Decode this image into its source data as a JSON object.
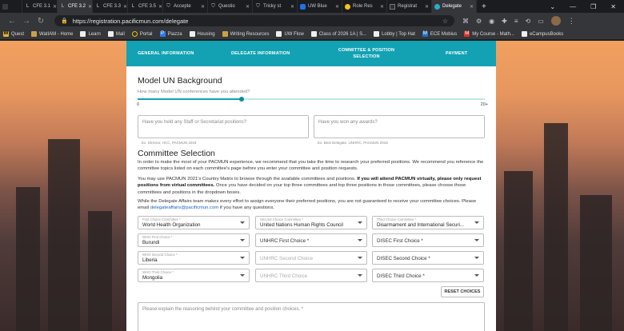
{
  "browser": {
    "tabs": [
      {
        "label": "CFE 3.1",
        "icon": "L"
      },
      {
        "label": "CFE 3.2",
        "icon": "L"
      },
      {
        "label": "CFE 3.3",
        "icon": "L"
      },
      {
        "label": "CFE 3.5",
        "icon": "L"
      },
      {
        "label": "Accepte",
        "icon": "shield"
      },
      {
        "label": "Questio",
        "icon": "shield"
      },
      {
        "label": "Tricky st",
        "icon": "shield"
      },
      {
        "label": "UW Blue",
        "icon": "blue"
      },
      {
        "label": "Role Res",
        "icon": "yellow"
      },
      {
        "label": "Registrat",
        "icon": "dark"
      },
      {
        "label": "Delegate",
        "icon": "teal"
      }
    ],
    "url": "https://registration.pacificmun.com/delegate",
    "bookmarks": [
      {
        "label": "Quest",
        "icon": "w"
      },
      {
        "label": "WatIAM - Home",
        "icon": "folder"
      },
      {
        "label": "Learn",
        "icon": "doc"
      },
      {
        "label": "Mail",
        "icon": "doc"
      },
      {
        "label": "Portal",
        "icon": "ring"
      },
      {
        "label": "Piazza",
        "icon": "p"
      },
      {
        "label": "Housing",
        "icon": "doc"
      },
      {
        "label": "Writing Resources",
        "icon": "folder"
      },
      {
        "label": "UW Flow",
        "icon": "doc"
      },
      {
        "label": "Class of 2026 1A | S...",
        "icon": "doc"
      },
      {
        "label": "Lobby | Top Hat",
        "icon": "doc"
      },
      {
        "label": "ECE Mobius",
        "icon": "ece"
      },
      {
        "label": "My Course - Math...",
        "icon": "red"
      },
      {
        "label": "eCampusBooks",
        "icon": "doc"
      }
    ]
  },
  "steps": [
    "GENERAL INFORMATION",
    "DELEGATE INFORMATION",
    "COMMITTEE & POSITION SELECTION",
    "PAYMENT"
  ],
  "background": {
    "title": "Model UN Background",
    "conferences_question": "How many Model UN conferences have you attended?",
    "slider_min": "0",
    "slider_max": "20+",
    "slider_value_fraction": 0.3,
    "staff_placeholder": "Have you held any Staff or Secretariat positions?",
    "staff_hint": "Ex. Director, HCC, PACMUN 2018",
    "awards_placeholder": "Have you won any awards?",
    "awards_hint": "Ex. Best Delegate, UNHRC, PACMUN 2018"
  },
  "committee": {
    "title": "Committee Selection",
    "p1": "In order to make the most of your PACMUN experience, we recommend that you take the time to research your preferred positions. We recommend you reference the committee topics listed on each committee's page before you enter your committee and position requests.",
    "p2_a": "You may use PACMUN 2021's Country Matrix to browse through the available committees and positions.",
    "p2_b": "If you will attend PACMUN virtually, please only request positions from virtual committees.",
    "p2_c": "Once you have decided on your top three committees and top three positions in those committees, please choose those committees and positions in the dropdown boxes.",
    "p3_a": "While the Delegate Affairs team makes every effort to assign everyone their preferred positions, you are not guaranteed to receive your committee choices. Please email",
    "p3_email": "delegateaffairs@pacificmun.com",
    "p3_b": "if you have any questions.",
    "first": {
      "label": "First Choice Committee *",
      "value": "World Health Organization"
    },
    "second": {
      "label": "Second Choice Committee *",
      "value": "United Nations Human Rights Council"
    },
    "third": {
      "label": "Third Choice Committee *",
      "value": "Disarmament and International Securi..."
    },
    "who1": {
      "label": "WHO First Choice *",
      "value": "Burundi"
    },
    "who2": {
      "label": "WHO Second Choice *",
      "value": "Liberia"
    },
    "who3": {
      "label": "WHO Third Choice *",
      "value": "Mongolia"
    },
    "unhrc1": "UNHRC First Choice *",
    "unhrc2": "UNHRC Second Choice",
    "unhrc3": "UNHRC Third Choice",
    "disec1": "DISEC First Choice *",
    "disec2": "DISEC Second Choice *",
    "disec3": "DISEC Third Choice *",
    "reset": "RESET CHOICES",
    "reasoning_placeholder": "Please explain the reasoning behind your committee and position choices. *"
  },
  "colors": {
    "accent": "#12a2b3"
  }
}
